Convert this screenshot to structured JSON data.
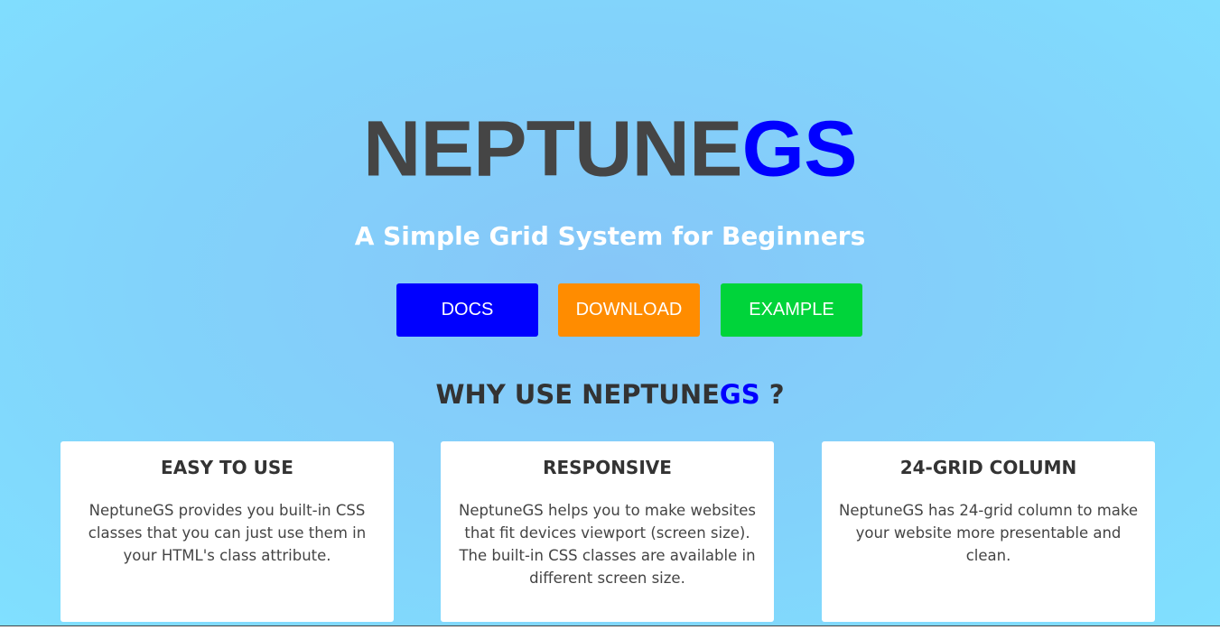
{
  "logo": {
    "main": "NEPTUNE",
    "accent": "GS"
  },
  "tagline": "A Simple Grid System for Beginners",
  "buttons": {
    "docs": "DOCS",
    "download": "DOWNLOAD",
    "example": "EXAMPLE"
  },
  "why": {
    "prefix": "WHY USE NEPTUNE",
    "accent": "GS",
    "suffix": " ?"
  },
  "features": [
    {
      "title": "EASY TO USE",
      "text": "NeptuneGS provides you built-in CSS classes that you can just use them in your HTML's class attribute."
    },
    {
      "title": "RESPONSIVE",
      "text": "NeptuneGS helps you to make websites that fit devices viewport (screen size). The built-in CSS classes are available in different screen size."
    },
    {
      "title": "24-GRID COLUMN",
      "text": "NeptuneGS has 24-grid column to make your website more presentable and clean."
    }
  ],
  "colors": {
    "accent_blue": "#0000ff",
    "docs_button": "#0000ff",
    "download_button": "#ff8c00",
    "example_button": "#00d43a",
    "logo_gray": "#454545",
    "background": "#82d3fb"
  }
}
